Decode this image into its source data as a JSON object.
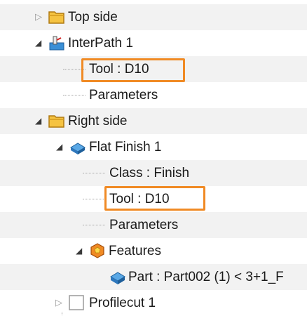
{
  "tree": {
    "top_side": {
      "label": "Top side",
      "icon": "folder-icon",
      "state": "collapsed"
    },
    "interpath": {
      "label": "InterPath 1",
      "icon": "interpath-icon",
      "state": "expanded"
    },
    "interpath_tool": {
      "label": "Tool : D10",
      "highlighted": true
    },
    "interpath_params": {
      "label": "Parameters"
    },
    "right_side": {
      "label": "Right side",
      "icon": "folder-icon",
      "state": "expanded"
    },
    "flat_finish": {
      "label": "Flat Finish 1",
      "icon": "flat-finish-icon",
      "state": "expanded"
    },
    "class": {
      "label": "Class : Finish"
    },
    "flat_tool": {
      "label": "Tool : D10",
      "highlighted": true
    },
    "flat_params": {
      "label": "Parameters"
    },
    "features": {
      "label": "Features",
      "icon": "features-icon",
      "state": "expanded"
    },
    "part": {
      "label": "Part : Part002 (1) < 3+1_F",
      "icon": "part-icon"
    },
    "profilecut": {
      "label": "Profilecut 1",
      "icon": "blank-box-icon",
      "state": "collapsed"
    }
  },
  "colors": {
    "highlight": "#f08a24",
    "row_alt": "#f2f2f2",
    "folder": "#f5c342"
  }
}
